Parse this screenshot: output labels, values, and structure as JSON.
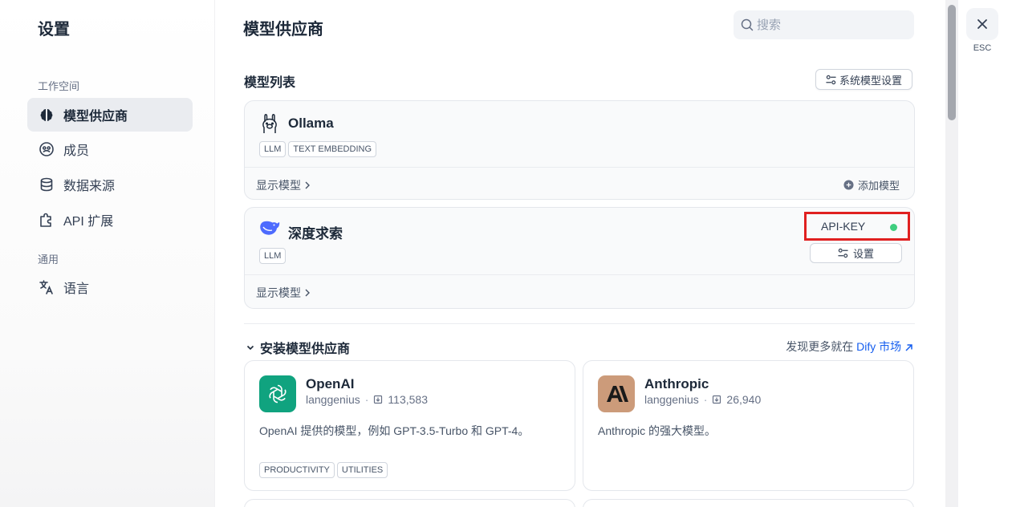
{
  "sidebar": {
    "title": "设置",
    "workspace_label": "工作空间",
    "general_label": "通用",
    "items": [
      {
        "label": "模型供应商"
      },
      {
        "label": "成员"
      },
      {
        "label": "数据来源"
      },
      {
        "label": "API 扩展"
      },
      {
        "label": "语言"
      }
    ]
  },
  "header": {
    "title": "模型供应商",
    "search_placeholder": "搜索"
  },
  "model_list": {
    "title": "模型列表",
    "system_settings_label": "系统模型设置",
    "providers": [
      {
        "name": "Ollama",
        "tags": [
          "LLM",
          "TEXT EMBEDDING"
        ],
        "show_models_label": "显示模型",
        "add_model_label": "添加模型"
      },
      {
        "name": "深度求索",
        "tags": [
          "LLM"
        ],
        "show_models_label": "显示模型",
        "api_key_label": "API-KEY",
        "api_key_status_color": "#3fce7f",
        "settings_label": "设置"
      }
    ]
  },
  "install": {
    "title": "安装模型供应商",
    "market_prefix": "发现更多就在",
    "market_link": "Dify 市场",
    "plugins": [
      {
        "name": "OpenAI",
        "author": "langgenius",
        "downloads": "113,583",
        "description": "OpenAI 提供的模型，例如 GPT-3.5-Turbo 和 GPT-4。",
        "tags": [
          "PRODUCTIVITY",
          "UTILITIES"
        ],
        "logo_color": "#10a37f"
      },
      {
        "name": "Anthropic",
        "author": "langgenius",
        "downloads": "26,940",
        "description": "Anthropic 的强大模型。",
        "tags": [],
        "logo_color": "#cc9b7a"
      }
    ]
  },
  "close": {
    "esc_label": "ESC"
  },
  "colors": {
    "accent": "#155eef",
    "highlight_border": "#e02020"
  }
}
